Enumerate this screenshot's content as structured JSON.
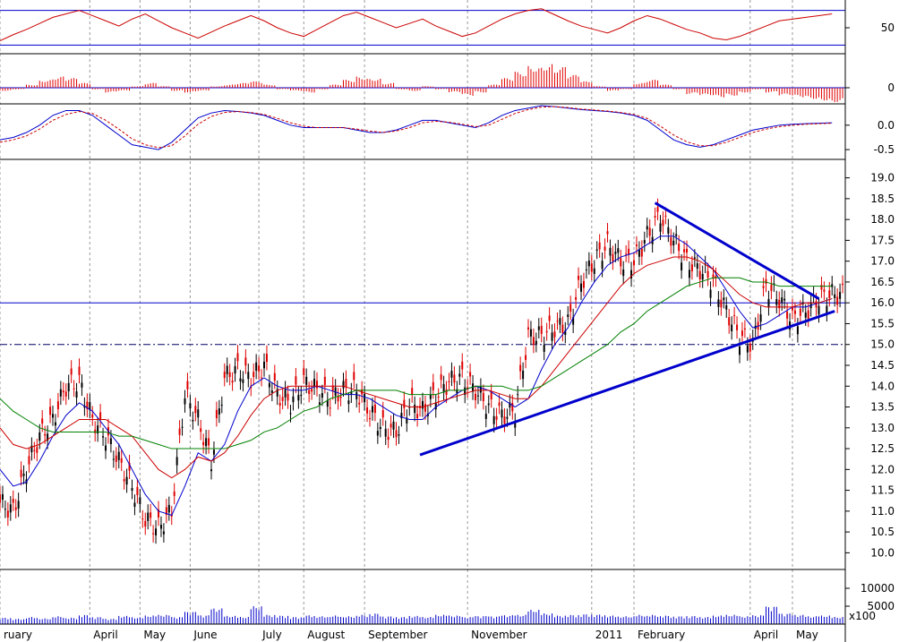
{
  "colors": {
    "up": "#000000",
    "down": "#e00000",
    "ma_fast": "#0000cc",
    "ma_mid": "#cc0000",
    "ma_slow": "#008000",
    "level_line": "#0000cc",
    "grid": "#999999"
  },
  "chart_data": [
    {
      "type": "line",
      "panel": "oscillator-rsi",
      "y_ticks": [
        "50"
      ],
      "reference_levels": [
        70,
        30
      ],
      "ylim": [
        20,
        80
      ],
      "x": [
        0,
        5,
        10,
        15,
        20,
        25,
        30,
        35,
        40,
        45,
        50,
        55,
        60,
        65,
        70,
        75,
        80,
        85,
        90,
        95,
        100,
        105,
        110,
        115,
        120,
        125,
        130,
        135,
        140,
        145,
        150,
        155,
        160,
        165,
        170,
        175,
        180,
        185,
        190,
        195,
        200,
        205,
        210,
        215,
        220,
        225,
        230,
        235,
        240,
        245,
        250,
        255,
        260,
        265,
        270,
        275,
        280,
        285,
        290,
        295,
        300,
        305,
        310,
        315
      ],
      "series": [
        {
          "values": [
            35,
            42,
            48,
            55,
            62,
            66,
            70,
            64,
            58,
            52,
            60,
            66,
            58,
            50,
            44,
            38,
            45,
            52,
            58,
            64,
            58,
            50,
            44,
            40,
            48,
            56,
            64,
            68,
            62,
            56,
            50,
            55,
            60,
            52,
            46,
            40,
            44,
            52,
            60,
            66,
            70,
            72,
            65,
            58,
            52,
            48,
            44,
            50,
            58,
            64,
            60,
            54,
            48,
            44,
            38,
            36,
            40,
            46,
            52,
            58,
            60,
            62,
            64,
            66
          ]
        }
      ]
    },
    {
      "type": "bar",
      "panel": "oscillator-histogram",
      "y_ticks": [
        "0"
      ],
      "ylim": [
        -20,
        40
      ],
      "x": [
        0,
        5,
        10,
        15,
        20,
        25,
        30,
        35,
        40,
        45,
        50,
        55,
        60,
        65,
        70,
        75,
        80,
        85,
        90,
        95,
        100,
        105,
        110,
        115,
        120,
        125,
        130,
        135,
        140,
        145,
        150,
        155,
        160,
        165,
        170,
        175,
        180,
        185,
        190,
        195,
        200,
        205,
        210,
        215,
        220,
        225,
        230,
        235,
        240,
        245,
        250,
        255,
        260,
        265,
        270,
        275,
        280,
        285,
        290,
        295,
        300,
        305,
        310,
        315
      ],
      "series": [
        {
          "values": [
            -4,
            -2,
            4,
            10,
            14,
            12,
            6,
            -2,
            -6,
            -4,
            2,
            6,
            2,
            -4,
            -6,
            -4,
            2,
            4,
            6,
            8,
            4,
            -2,
            -4,
            -6,
            -2,
            4,
            10,
            14,
            12,
            6,
            -2,
            -4,
            2,
            -2,
            -6,
            -10,
            -6,
            4,
            12,
            20,
            28,
            30,
            26,
            16,
            8,
            2,
            -4,
            -2,
            6,
            10,
            4,
            -2,
            -8,
            -10,
            -12,
            -10,
            -6,
            -2,
            -6,
            -10,
            -12,
            -14,
            -16,
            -18
          ]
        }
      ]
    },
    {
      "type": "line",
      "panel": "oscillator-macd",
      "y_ticks": [
        "0.0",
        "-0.5"
      ],
      "ylim": [
        -0.7,
        0.4
      ],
      "x": [
        0,
        5,
        10,
        15,
        20,
        25,
        30,
        35,
        40,
        45,
        50,
        55,
        60,
        65,
        70,
        75,
        80,
        85,
        90,
        95,
        100,
        105,
        110,
        115,
        120,
        125,
        130,
        135,
        140,
        145,
        150,
        155,
        160,
        165,
        170,
        175,
        180,
        185,
        190,
        195,
        200,
        205,
        210,
        215,
        220,
        225,
        230,
        235,
        240,
        245,
        250,
        255,
        260,
        265,
        270,
        275,
        280,
        285,
        290,
        295,
        300,
        305,
        310,
        315
      ],
      "series": [
        {
          "values": [
            -0.3,
            -0.25,
            -0.15,
            0.0,
            0.2,
            0.3,
            0.3,
            0.2,
            0.0,
            -0.2,
            -0.4,
            -0.45,
            -0.5,
            -0.35,
            -0.1,
            0.15,
            0.25,
            0.3,
            0.28,
            0.25,
            0.2,
            0.1,
            0.0,
            -0.05,
            -0.05,
            -0.05,
            -0.05,
            -0.1,
            -0.15,
            -0.15,
            -0.1,
            0.0,
            0.1,
            0.1,
            0.05,
            0.0,
            -0.05,
            0.05,
            0.2,
            0.3,
            0.35,
            0.4,
            0.38,
            0.35,
            0.32,
            0.3,
            0.28,
            0.25,
            0.2,
            0.1,
            -0.1,
            -0.3,
            -0.4,
            -0.45,
            -0.4,
            -0.3,
            -0.2,
            -0.1,
            -0.05,
            0.0,
            0.02,
            0.03,
            0.04,
            0.05
          ]
        },
        {
          "values": [
            -0.35,
            -0.3,
            -0.22,
            -0.08,
            0.1,
            0.22,
            0.28,
            0.24,
            0.1,
            -0.08,
            -0.28,
            -0.4,
            -0.46,
            -0.42,
            -0.22,
            0.02,
            0.18,
            0.26,
            0.28,
            0.26,
            0.22,
            0.14,
            0.05,
            -0.02,
            -0.05,
            -0.05,
            -0.05,
            -0.08,
            -0.12,
            -0.15,
            -0.12,
            -0.05,
            0.05,
            0.08,
            0.06,
            0.02,
            -0.03,
            0.0,
            0.12,
            0.24,
            0.32,
            0.37,
            0.38,
            0.36,
            0.33,
            0.31,
            0.29,
            0.26,
            0.22,
            0.14,
            -0.02,
            -0.2,
            -0.34,
            -0.42,
            -0.42,
            -0.35,
            -0.25,
            -0.15,
            -0.08,
            -0.03,
            0.0,
            0.02,
            0.03,
            0.04
          ]
        }
      ]
    },
    {
      "type": "line",
      "panel": "price",
      "y_ticks": [
        "19.0",
        "18.5",
        "18.0",
        "17.5",
        "17.0",
        "16.5",
        "16.0",
        "15.5",
        "15.0",
        "14.5",
        "14.0",
        "13.5",
        "13.0",
        "12.5",
        "12.0",
        "11.5",
        "11.0",
        "10.5",
        "10.0"
      ],
      "ylim": [
        9.6,
        19.4
      ],
      "reference_levels": [
        16.0,
        15.0
      ],
      "trendlines": [
        {
          "x1": 159,
          "y1": 12.35,
          "x2": 316,
          "y2": 15.8
        },
        {
          "x1": 248,
          "y1": 18.4,
          "x2": 310,
          "y2": 16.1
        }
      ],
      "x": [
        0,
        5,
        10,
        15,
        20,
        25,
        30,
        35,
        40,
        45,
        50,
        55,
        60,
        65,
        70,
        75,
        80,
        85,
        90,
        95,
        100,
        105,
        110,
        115,
        120,
        125,
        130,
        135,
        140,
        145,
        150,
        155,
        160,
        165,
        170,
        175,
        180,
        185,
        190,
        195,
        200,
        205,
        210,
        215,
        220,
        225,
        230,
        235,
        240,
        245,
        250,
        255,
        260,
        265,
        270,
        275,
        280,
        285,
        290,
        295,
        300,
        305,
        310,
        315
      ],
      "series": [
        {
          "name": "price",
          "values": [
            11.2,
            11.0,
            12.0,
            12.8,
            13.2,
            14.0,
            14.1,
            13.2,
            12.8,
            12.2,
            11.6,
            10.8,
            10.6,
            11.0,
            13.8,
            13.2,
            12.2,
            14.2,
            14.4,
            14.2,
            14.5,
            13.8,
            13.6,
            14.1,
            13.9,
            13.7,
            13.9,
            13.9,
            13.4,
            13.0,
            12.9,
            13.6,
            13.4,
            13.8,
            14.1,
            14.2,
            13.9,
            13.5,
            13.3,
            13.4,
            15.2,
            15.2,
            15.4,
            15.5,
            16.5,
            17.0,
            17.4,
            17.0,
            17.0,
            17.6,
            18.1,
            17.5,
            17.0,
            16.8,
            16.5,
            15.8,
            15.2,
            15.0,
            16.4,
            16.1,
            15.6,
            15.8,
            16.1,
            16.2
          ]
        },
        {
          "name": "ma-fast",
          "values": [
            12.0,
            11.6,
            11.7,
            12.2,
            12.8,
            13.3,
            13.6,
            13.4,
            13.0,
            12.6,
            12.0,
            11.4,
            11.0,
            10.9,
            11.6,
            12.4,
            12.2,
            12.6,
            13.4,
            14.0,
            14.2,
            14.0,
            13.9,
            13.9,
            14.0,
            13.9,
            13.8,
            13.8,
            13.7,
            13.5,
            13.3,
            13.2,
            13.2,
            13.5,
            13.7,
            13.9,
            14.0,
            13.9,
            13.7,
            13.5,
            13.7,
            14.4,
            15.0,
            15.4,
            16.0,
            16.5,
            16.9,
            17.1,
            17.2,
            17.4,
            17.6,
            17.6,
            17.4,
            17.1,
            16.8,
            16.3,
            15.8,
            15.4,
            15.5,
            15.7,
            15.9,
            15.9,
            16.0,
            16.1
          ]
        },
        {
          "name": "ma-mid",
          "values": [
            13.0,
            12.6,
            12.5,
            12.6,
            12.8,
            13.0,
            13.2,
            13.2,
            13.2,
            13.0,
            12.8,
            12.4,
            12.0,
            11.8,
            12.0,
            12.3,
            12.2,
            12.4,
            12.8,
            13.3,
            13.7,
            13.9,
            14.0,
            14.0,
            14.0,
            14.0,
            14.0,
            13.9,
            13.8,
            13.7,
            13.6,
            13.5,
            13.5,
            13.6,
            13.7,
            13.8,
            13.9,
            13.9,
            13.8,
            13.7,
            13.7,
            14.0,
            14.4,
            14.8,
            15.2,
            15.6,
            16.0,
            16.4,
            16.7,
            16.9,
            17.0,
            17.1,
            17.1,
            17.0,
            16.8,
            16.5,
            16.2,
            16.0,
            15.9,
            15.9,
            15.9,
            16.0,
            16.0,
            16.1
          ]
        },
        {
          "name": "ma-slow",
          "values": [
            13.7,
            13.4,
            13.2,
            13.0,
            12.9,
            12.9,
            12.9,
            12.9,
            12.9,
            12.8,
            12.8,
            12.7,
            12.6,
            12.5,
            12.5,
            12.5,
            12.5,
            12.5,
            12.6,
            12.7,
            12.9,
            13.0,
            13.2,
            13.4,
            13.5,
            13.7,
            13.8,
            13.9,
            13.9,
            13.9,
            13.9,
            13.8,
            13.8,
            13.8,
            13.9,
            13.9,
            14.0,
            14.0,
            14.0,
            13.9,
            13.9,
            14.0,
            14.2,
            14.4,
            14.6,
            14.8,
            15.0,
            15.3,
            15.5,
            15.8,
            16.0,
            16.2,
            16.4,
            16.5,
            16.6,
            16.6,
            16.6,
            16.5,
            16.5,
            16.4,
            16.4,
            16.4,
            16.4,
            16.4
          ]
        }
      ]
    },
    {
      "type": "bar",
      "panel": "volume",
      "y_ticks": [
        "10000",
        "5000"
      ],
      "y_unit_note": "x100",
      "ylim": [
        0,
        15000
      ],
      "x_month_labels": [
        "ruary",
        "April",
        "May",
        "June",
        "July",
        "August",
        "September",
        "November",
        "2011",
        "February",
        "April",
        "May"
      ],
      "x_month_pos": [
        0,
        34,
        53,
        72,
        98,
        115,
        138,
        177,
        224,
        240,
        284,
        300
      ],
      "x": [
        0,
        5,
        10,
        15,
        20,
        25,
        30,
        35,
        40,
        45,
        50,
        55,
        60,
        65,
        70,
        75,
        80,
        85,
        90,
        95,
        100,
        105,
        110,
        115,
        120,
        125,
        130,
        135,
        140,
        145,
        150,
        155,
        160,
        165,
        170,
        175,
        180,
        185,
        190,
        195,
        200,
        205,
        210,
        215,
        220,
        225,
        230,
        235,
        240,
        245,
        250,
        255,
        260,
        265,
        270,
        275,
        280,
        285,
        290,
        295,
        300,
        305,
        310,
        315
      ],
      "series": [
        {
          "values": [
            1800,
            1500,
            2000,
            1600,
            2200,
            1800,
            2600,
            2000,
            1500,
            2300,
            1900,
            2400,
            2600,
            2000,
            3500,
            2500,
            4400,
            2300,
            2000,
            5000,
            2600,
            2400,
            2000,
            2500,
            2200,
            2400,
            2200,
            2600,
            3000,
            2200,
            2000,
            2300,
            2000,
            2600,
            2400,
            2000,
            2300,
            2200,
            2500,
            2600,
            4000,
            3000,
            2400,
            2600,
            2800,
            2700,
            2400,
            2200,
            2600,
            2600,
            2400,
            2200,
            2300,
            2000,
            2400,
            2600,
            2200,
            2500,
            5000,
            3000,
            2600,
            2200,
            2400,
            2000
          ]
        }
      ]
    }
  ]
}
